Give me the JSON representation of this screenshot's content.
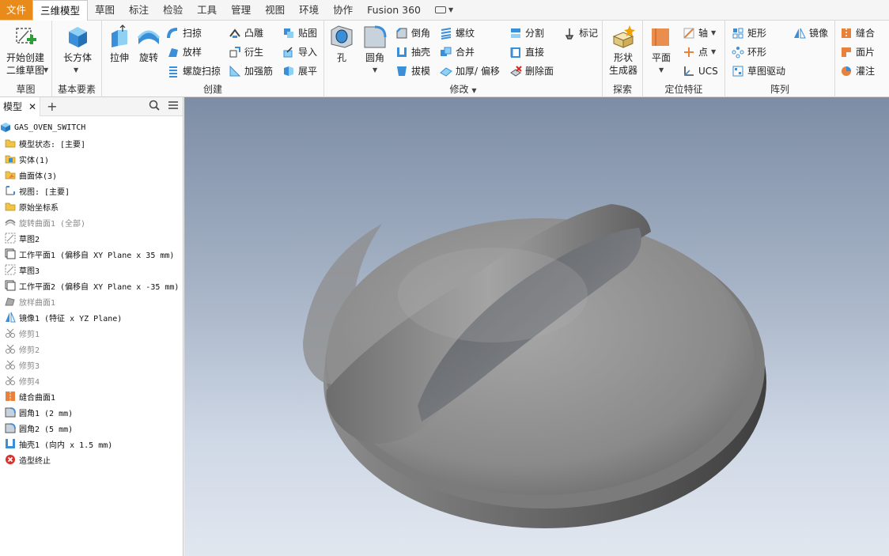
{
  "menu": {
    "file": "文件",
    "tabs": [
      "三维模型",
      "草图",
      "标注",
      "检验",
      "工具",
      "管理",
      "视图",
      "环境",
      "协作",
      "Fusion 360"
    ]
  },
  "ribbon": {
    "sketch": {
      "start_2d_sketch": "开始创建\n二维草图",
      "label": "草图"
    },
    "primitives": {
      "box": "长方体",
      "label": "基本要素"
    },
    "create": {
      "extrude": "拉伸",
      "revolve": "旋转",
      "sweep": "扫掠",
      "loft": "放样",
      "coil": "螺旋扫掠",
      "emboss": "凸雕",
      "derive": "衍生",
      "rib": "加强筋",
      "decal": "贴图",
      "import": "导入",
      "unfold": "展平",
      "label": "创建"
    },
    "modify": {
      "hole": "孔",
      "fillet": "圆角",
      "chamfer": "倒角",
      "shell": "抽壳",
      "draft": "拔模",
      "thread": "螺纹",
      "combine": "合并",
      "thicken": "加厚/ 偏移",
      "split": "分割",
      "direct": "直接",
      "delete_face": "删除面",
      "mark": "标记",
      "label": "修改"
    },
    "explore": {
      "shape_generator": "形状\n生成器",
      "label": "探索"
    },
    "work_features": {
      "plane": "平面",
      "axis": "轴",
      "point": "点",
      "ucs": "UCS",
      "label": "定位特征"
    },
    "pattern": {
      "rectangular": "矩形",
      "circular": "环形",
      "sketch_driven": "草图驱动",
      "mirror": "镜像",
      "label": "阵列"
    },
    "surface": {
      "stitch": "缝合",
      "patch": "面片",
      "sculpt": "灌注"
    }
  },
  "browser": {
    "tab_label": "模型",
    "root": "GAS_OVEN_SWITCH",
    "nodes": [
      {
        "text": "模型状态: [主要]",
        "icon": "folder-icon",
        "gray": false
      },
      {
        "text": "实体(1)",
        "icon": "solid-body-icon",
        "gray": false
      },
      {
        "text": "曲面体(3)",
        "icon": "surface-body-icon",
        "gray": false
      },
      {
        "text": "视图: [主要]",
        "icon": "view-icon",
        "gray": false
      },
      {
        "text": "原始坐标系",
        "icon": "folder-icon",
        "gray": false
      },
      {
        "text": "旋转曲面1 (全部)",
        "icon": "revolve-surface-icon",
        "gray": true
      },
      {
        "text": "草图2",
        "icon": "sketch-icon",
        "gray": false
      },
      {
        "text": "工作平面1 (偏移自 XY Plane x 35 mm)",
        "icon": "work-plane-icon",
        "gray": false
      },
      {
        "text": "草图3",
        "icon": "sketch-icon",
        "gray": false
      },
      {
        "text": "工作平面2 (偏移自 XY Plane x -35 mm)",
        "icon": "work-plane-icon",
        "gray": false
      },
      {
        "text": "放样曲面1",
        "icon": "loft-surface-icon",
        "gray": true
      },
      {
        "text": "镜像1 (特征 x YZ Plane)",
        "icon": "mirror-icon",
        "gray": false
      },
      {
        "text": "修剪1",
        "icon": "trim-icon",
        "gray": true
      },
      {
        "text": "修剪2",
        "icon": "trim-icon",
        "gray": true
      },
      {
        "text": "修剪3",
        "icon": "trim-icon",
        "gray": true
      },
      {
        "text": "修剪4",
        "icon": "trim-icon",
        "gray": true
      },
      {
        "text": "缝合曲面1",
        "icon": "stitch-icon",
        "gray": false
      },
      {
        "text": "圆角1 (2 mm)",
        "icon": "fillet-icon",
        "gray": false
      },
      {
        "text": "圆角2 (5 mm)",
        "icon": "fillet-icon",
        "gray": false
      },
      {
        "text": "抽壳1 (向内 x 1.5 mm)",
        "icon": "shell-icon",
        "gray": false
      },
      {
        "text": "造型终止",
        "icon": "end-of-part-icon",
        "gray": false
      }
    ]
  },
  "colors": {
    "file_tab": "#e98b1a",
    "accent_blue": "#3b8ed8",
    "orange": "#e8823a"
  }
}
